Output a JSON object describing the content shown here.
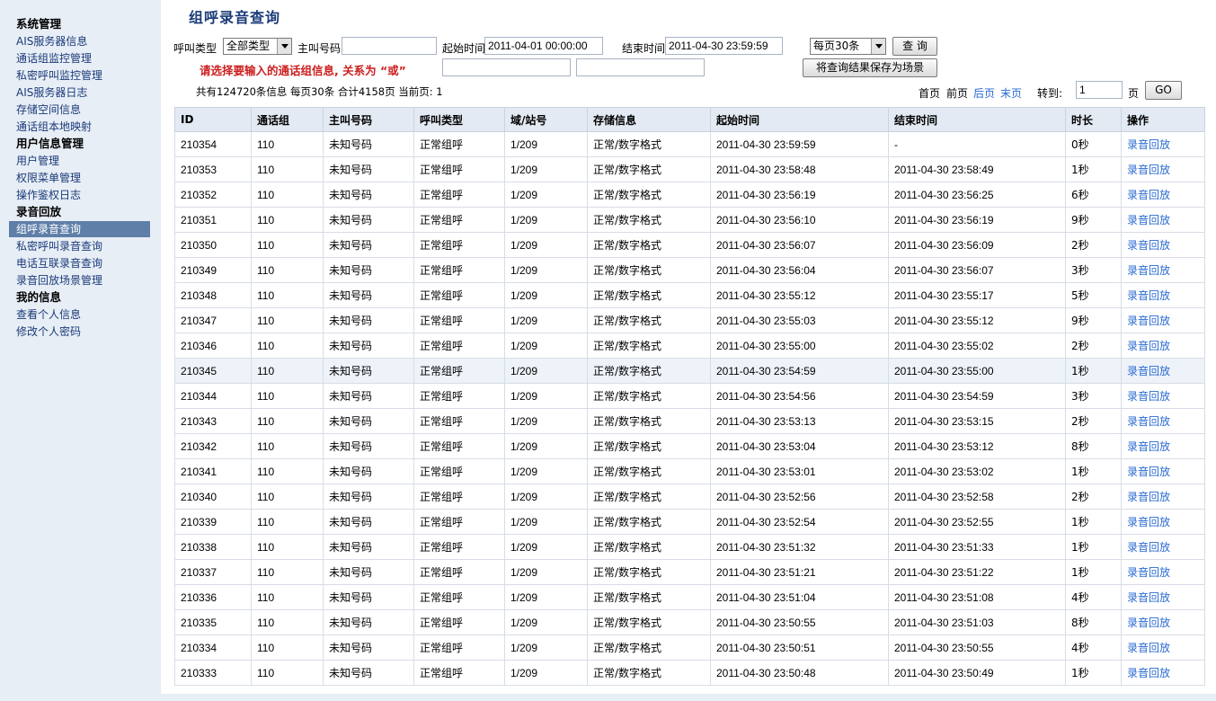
{
  "sidebar": {
    "groups": [
      {
        "head": "系统管理",
        "items": [
          "AIS服务器信息",
          "通话组监控管理",
          "私密呼叫监控管理",
          "AIS服务器日志",
          "存储空间信息",
          "通话组本地映射"
        ]
      },
      {
        "head": "用户信息管理",
        "items": [
          "用户管理",
          "权限菜单管理",
          "操作鉴权日志"
        ]
      },
      {
        "head": "录音回放",
        "items": [
          "组呼录音查询",
          "私密呼叫录音查询",
          "电话互联录音查询",
          "录音回放场景管理"
        ]
      },
      {
        "head": "我的信息",
        "items": [
          "查看个人信息",
          "修改个人密码"
        ]
      }
    ],
    "active": "组呼录音查询"
  },
  "page_title": "组呼录音查询",
  "filters": {
    "call_type_label": "呼叫类型",
    "call_type_value": "全部类型",
    "caller_label": "主叫号码",
    "caller_value": "",
    "start_label": "起始时间",
    "start_value": "2011-04-01 00:00:00",
    "end_label": "结束时间",
    "end_value": "2011-04-30 23:59:59",
    "page_size_value": "每页30条",
    "query_button": "查 询",
    "save_button": "将查询结果保存为场景",
    "warning": "请选择要输入的通话组信息, 关系为 “或”",
    "group_input_1": "",
    "group_input_2": ""
  },
  "summary": {
    "text": "共有124720条信息  每页30条  合计4158页   当前页: 1"
  },
  "pager": {
    "first": "首页",
    "prev": "前页",
    "next": "后页",
    "last": "末页",
    "goto_label": "转到:",
    "goto_value": "1",
    "page_unit": "页",
    "go_button": "GO"
  },
  "table": {
    "columns": [
      "ID",
      "通话组",
      "主叫号码",
      "呼叫类型",
      "域/站号",
      "存储信息",
      "起始时间",
      "结束时间",
      "时长",
      "操作"
    ],
    "rows": [
      [
        "210354",
        "110",
        "未知号码",
        "正常组呼",
        "1/209",
        "正常/数字格式",
        "2011-04-30 23:59:59",
        "-",
        "0秒",
        "录音回放"
      ],
      [
        "210353",
        "110",
        "未知号码",
        "正常组呼",
        "1/209",
        "正常/数字格式",
        "2011-04-30 23:58:48",
        "2011-04-30 23:58:49",
        "1秒",
        "录音回放"
      ],
      [
        "210352",
        "110",
        "未知号码",
        "正常组呼",
        "1/209",
        "正常/数字格式",
        "2011-04-30 23:56:19",
        "2011-04-30 23:56:25",
        "6秒",
        "录音回放"
      ],
      [
        "210351",
        "110",
        "未知号码",
        "正常组呼",
        "1/209",
        "正常/数字格式",
        "2011-04-30 23:56:10",
        "2011-04-30 23:56:19",
        "9秒",
        "录音回放"
      ],
      [
        "210350",
        "110",
        "未知号码",
        "正常组呼",
        "1/209",
        "正常/数字格式",
        "2011-04-30 23:56:07",
        "2011-04-30 23:56:09",
        "2秒",
        "录音回放"
      ],
      [
        "210349",
        "110",
        "未知号码",
        "正常组呼",
        "1/209",
        "正常/数字格式",
        "2011-04-30 23:56:04",
        "2011-04-30 23:56:07",
        "3秒",
        "录音回放"
      ],
      [
        "210348",
        "110",
        "未知号码",
        "正常组呼",
        "1/209",
        "正常/数字格式",
        "2011-04-30 23:55:12",
        "2011-04-30 23:55:17",
        "5秒",
        "录音回放"
      ],
      [
        "210347",
        "110",
        "未知号码",
        "正常组呼",
        "1/209",
        "正常/数字格式",
        "2011-04-30 23:55:03",
        "2011-04-30 23:55:12",
        "9秒",
        "录音回放"
      ],
      [
        "210346",
        "110",
        "未知号码",
        "正常组呼",
        "1/209",
        "正常/数字格式",
        "2011-04-30 23:55:00",
        "2011-04-30 23:55:02",
        "2秒",
        "录音回放"
      ],
      [
        "210345",
        "110",
        "未知号码",
        "正常组呼",
        "1/209",
        "正常/数字格式",
        "2011-04-30 23:54:59",
        "2011-04-30 23:55:00",
        "1秒",
        "录音回放"
      ],
      [
        "210344",
        "110",
        "未知号码",
        "正常组呼",
        "1/209",
        "正常/数字格式",
        "2011-04-30 23:54:56",
        "2011-04-30 23:54:59",
        "3秒",
        "录音回放"
      ],
      [
        "210343",
        "110",
        "未知号码",
        "正常组呼",
        "1/209",
        "正常/数字格式",
        "2011-04-30 23:53:13",
        "2011-04-30 23:53:15",
        "2秒",
        "录音回放"
      ],
      [
        "210342",
        "110",
        "未知号码",
        "正常组呼",
        "1/209",
        "正常/数字格式",
        "2011-04-30 23:53:04",
        "2011-04-30 23:53:12",
        "8秒",
        "录音回放"
      ],
      [
        "210341",
        "110",
        "未知号码",
        "正常组呼",
        "1/209",
        "正常/数字格式",
        "2011-04-30 23:53:01",
        "2011-04-30 23:53:02",
        "1秒",
        "录音回放"
      ],
      [
        "210340",
        "110",
        "未知号码",
        "正常组呼",
        "1/209",
        "正常/数字格式",
        "2011-04-30 23:52:56",
        "2011-04-30 23:52:58",
        "2秒",
        "录音回放"
      ],
      [
        "210339",
        "110",
        "未知号码",
        "正常组呼",
        "1/209",
        "正常/数字格式",
        "2011-04-30 23:52:54",
        "2011-04-30 23:52:55",
        "1秒",
        "录音回放"
      ],
      [
        "210338",
        "110",
        "未知号码",
        "正常组呼",
        "1/209",
        "正常/数字格式",
        "2011-04-30 23:51:32",
        "2011-04-30 23:51:33",
        "1秒",
        "录音回放"
      ],
      [
        "210337",
        "110",
        "未知号码",
        "正常组呼",
        "1/209",
        "正常/数字格式",
        "2011-04-30 23:51:21",
        "2011-04-30 23:51:22",
        "1秒",
        "录音回放"
      ],
      [
        "210336",
        "110",
        "未知号码",
        "正常组呼",
        "1/209",
        "正常/数字格式",
        "2011-04-30 23:51:04",
        "2011-04-30 23:51:08",
        "4秒",
        "录音回放"
      ],
      [
        "210335",
        "110",
        "未知号码",
        "正常组呼",
        "1/209",
        "正常/数字格式",
        "2011-04-30 23:50:55",
        "2011-04-30 23:51:03",
        "8秒",
        "录音回放"
      ],
      [
        "210334",
        "110",
        "未知号码",
        "正常组呼",
        "1/209",
        "正常/数字格式",
        "2011-04-30 23:50:51",
        "2011-04-30 23:50:55",
        "4秒",
        "录音回放"
      ],
      [
        "210333",
        "110",
        "未知号码",
        "正常组呼",
        "1/209",
        "正常/数字格式",
        "2011-04-30 23:50:48",
        "2011-04-30 23:50:49",
        "1秒",
        "录音回放"
      ]
    ],
    "highlighted_row": "210345"
  },
  "colors": {
    "sidebar_bg": "#e8eef6",
    "active_bg": "#5f7fa8",
    "link": "#2a6ad0",
    "warning": "#cc1f1f",
    "header_bg": "#e3eaf3"
  }
}
